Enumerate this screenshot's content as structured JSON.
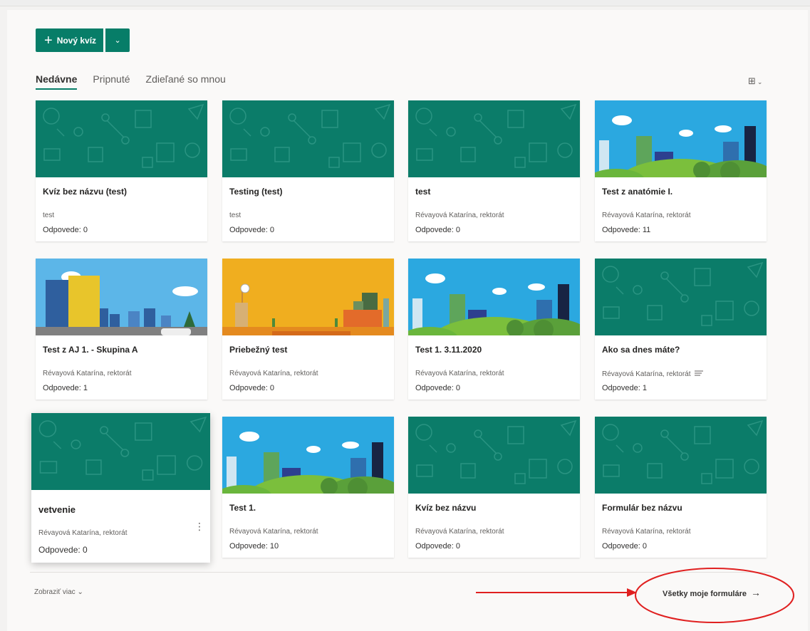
{
  "toolbar": {
    "new_quiz_label": "Nový kvíz",
    "plus_glyph": "+",
    "dropdown_glyph": "⌄"
  },
  "tabs": [
    {
      "label": "Nedávne",
      "active": true
    },
    {
      "label": "Pripnuté",
      "active": false
    },
    {
      "label": "Zdieľané so mnou",
      "active": false
    }
  ],
  "view_toggle": {
    "icon": "grid-view-icon",
    "glyph": "⊞",
    "chevron": "⌄"
  },
  "cards": [
    {
      "title": "Kvíz bez názvu (test)",
      "owner": "test",
      "responses": "Odpovede: 0",
      "theme": "pattern"
    },
    {
      "title": "Testing (test)",
      "owner": "test",
      "responses": "Odpovede: 0",
      "theme": "pattern"
    },
    {
      "title": "test",
      "owner": "Révayová Katarína, rektorát",
      "responses": "Odpovede: 0",
      "theme": "pattern"
    },
    {
      "title": "Test z anatómie I.",
      "owner": "Révayová Katarína, rektorát",
      "responses": "Odpovede: 11",
      "theme": "city-green"
    },
    {
      "title": "Test z AJ 1. - Skupina A",
      "owner": "Révayová Katarína, rektorát",
      "responses": "Odpovede: 1",
      "theme": "city-street"
    },
    {
      "title": "Priebežný test",
      "owner": "Révayová Katarína, rektorát",
      "responses": "Odpovede: 0",
      "theme": "orange"
    },
    {
      "title": "Test 1. 3.11.2020",
      "owner": "Révayová Katarína, rektorát",
      "responses": "Odpovede: 0",
      "theme": "city-green"
    },
    {
      "title": "Ako sa dnes máte?",
      "owner": "Révayová Katarína, rektorát",
      "responses": "Odpovede: 1",
      "theme": "pattern",
      "shared": true
    },
    {
      "title": "vetvenie",
      "owner": "Révayová Katarína, rektorát",
      "responses": "Odpovede: 0",
      "theme": "pattern",
      "selected": true
    },
    {
      "title": "Test 1.",
      "owner": "Révayová Katarína, rektorát",
      "responses": "Odpovede: 10",
      "theme": "city-green"
    },
    {
      "title": "Kvíz bez názvu",
      "owner": "Révayová Katarína, rektorát",
      "responses": "Odpovede: 0",
      "theme": "pattern"
    },
    {
      "title": "Formulár bez názvu",
      "owner": "Révayová Katarína, rektorát",
      "responses": "Odpovede: 0",
      "theme": "pattern"
    }
  ],
  "card_more_glyph": "⋮",
  "footer": {
    "show_more_label": "Zobraziť viac",
    "show_more_chevron": "⌄",
    "all_forms_label": "Všetky moje formuláre",
    "all_forms_arrow": "→"
  },
  "colors": {
    "accent": "#077d68",
    "annotation": "#e02020"
  }
}
